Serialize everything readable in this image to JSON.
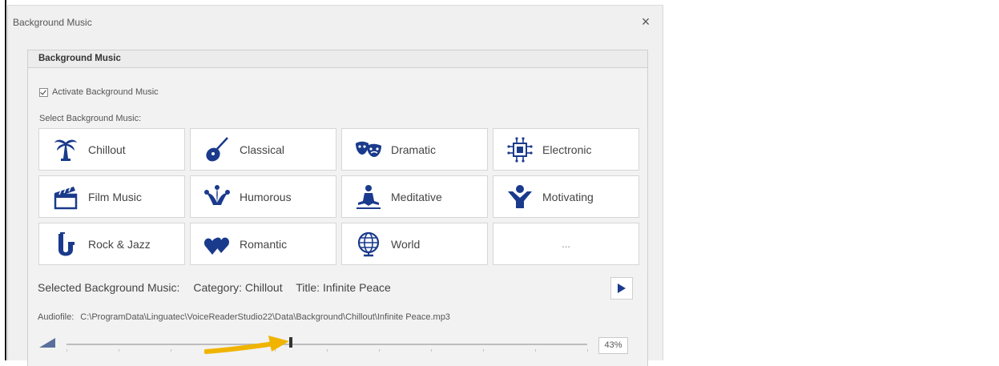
{
  "window": {
    "title": "Background Music",
    "close_icon": "close-icon",
    "close_label": "×"
  },
  "group": {
    "header": "Background Music",
    "activate_label": "Activate Background Music",
    "activate_checked": true,
    "select_label": "Select Background Music:"
  },
  "tiles": [
    {
      "label": "Chillout",
      "icon": "palm-tree-icon"
    },
    {
      "label": "Classical",
      "icon": "guitar-icon"
    },
    {
      "label": "Dramatic",
      "icon": "theater-masks-icon"
    },
    {
      "label": "Electronic",
      "icon": "circuit-icon"
    },
    {
      "label": "Film Music",
      "icon": "clapperboard-icon"
    },
    {
      "label": "Humorous",
      "icon": "jester-hat-icon"
    },
    {
      "label": "Meditative",
      "icon": "meditation-icon"
    },
    {
      "label": "Motivating",
      "icon": "cheering-person-icon"
    },
    {
      "label": "Rock & Jazz",
      "icon": "saxophone-icon"
    },
    {
      "label": "Romantic",
      "icon": "hearts-icon"
    },
    {
      "label": "World",
      "icon": "globe-icon"
    },
    {
      "label": "...",
      "icon": ""
    }
  ],
  "selection": {
    "prefix": "Selected Background Music:",
    "category": "Category: Chillout",
    "title": "Title: Infinite Peace"
  },
  "audio": {
    "label": "Audiofile:",
    "path": "C:\\ProgramData\\Linguatec\\VoiceReaderStudio22\\Data\\Background\\Chillout\\Infinite Peace.mp3"
  },
  "volume": {
    "value": 0.43,
    "display": "43%"
  },
  "colors": {
    "icon": "#1a3a8c",
    "arrow": "#f0b400",
    "play": "#1a3a8c"
  }
}
